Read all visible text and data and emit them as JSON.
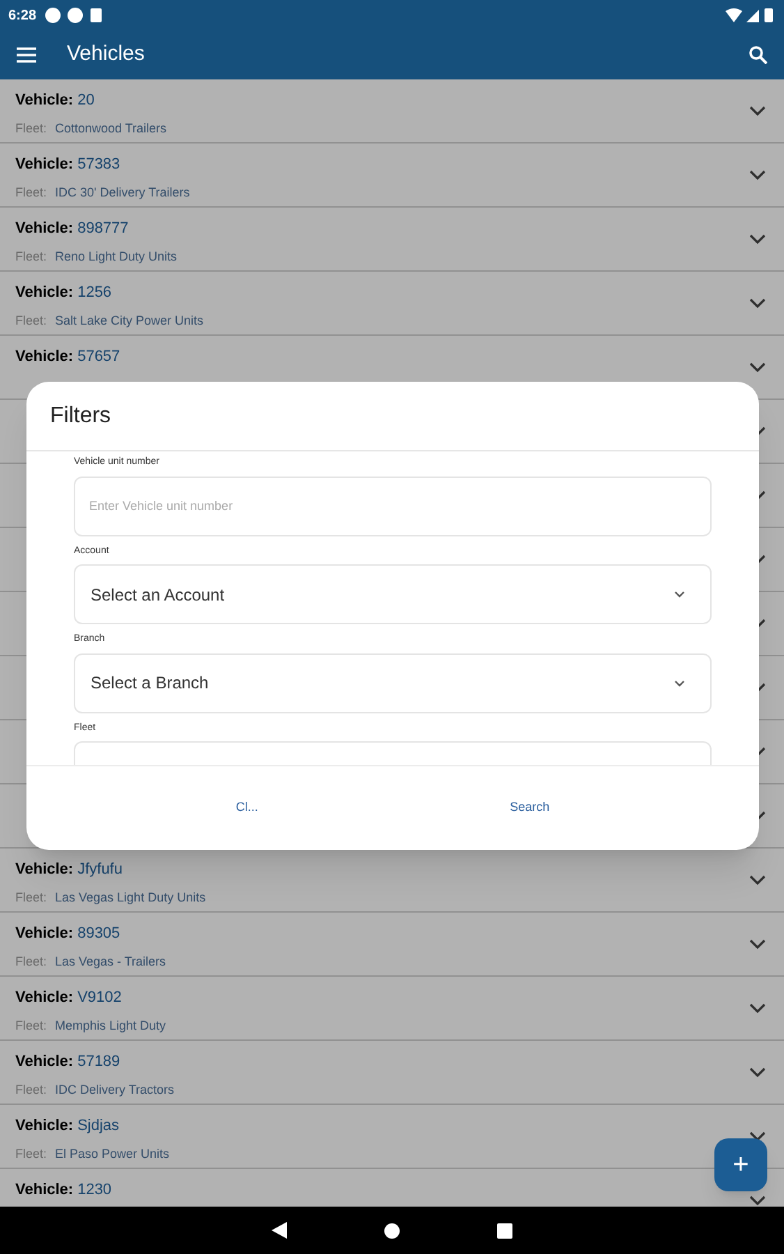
{
  "status_bar": {
    "time": "6:28"
  },
  "app_bar": {
    "title": "Vehicles"
  },
  "rows": [
    {
      "kind": "item",
      "vehicle_label": "Vehicle:",
      "vehicle": "20",
      "fleet_label": "Fleet:",
      "fleet": "Cottonwood Trailers"
    },
    {
      "kind": "item",
      "vehicle_label": "Vehicle:",
      "vehicle": "57383",
      "fleet_label": "Fleet:",
      "fleet": "IDC 30' Delivery Trailers"
    },
    {
      "kind": "item",
      "vehicle_label": "Vehicle:",
      "vehicle": "898777",
      "fleet_label": "Fleet:",
      "fleet": "Reno Light Duty Units"
    },
    {
      "kind": "item",
      "vehicle_label": "Vehicle:",
      "vehicle": "1256",
      "fleet_label": "Fleet:",
      "fleet": "Salt Lake City Power Units"
    },
    {
      "kind": "item",
      "vehicle_label": "Vehicle:",
      "vehicle": "57657"
    },
    {
      "kind": "covered"
    },
    {
      "kind": "covered"
    },
    {
      "kind": "covered"
    },
    {
      "kind": "covered"
    },
    {
      "kind": "covered"
    },
    {
      "kind": "covered"
    },
    {
      "kind": "covered"
    },
    {
      "kind": "item",
      "vehicle_label": "Vehicle:",
      "vehicle": "Jfyfufu",
      "fleet_label": "Fleet:",
      "fleet": "Las Vegas Light Duty Units"
    },
    {
      "kind": "item",
      "vehicle_label": "Vehicle:",
      "vehicle": "89305",
      "fleet_label": "Fleet:",
      "fleet": "Las Vegas - Trailers"
    },
    {
      "kind": "item",
      "vehicle_label": "Vehicle:",
      "vehicle": "V9102",
      "fleet_label": "Fleet:",
      "fleet": "Memphis Light Duty"
    },
    {
      "kind": "item",
      "vehicle_label": "Vehicle:",
      "vehicle": "57189",
      "fleet_label": "Fleet:",
      "fleet": "IDC Delivery Tractors"
    },
    {
      "kind": "item",
      "vehicle_label": "Vehicle:",
      "vehicle": "Sjdjas",
      "fleet_label": "Fleet:",
      "fleet": "El Paso Power Units"
    },
    {
      "kind": "item",
      "vehicle_label": "Vehicle:",
      "vehicle": "1230"
    }
  ],
  "dialog": {
    "title": "Filters",
    "fields": [
      {
        "kind": "text",
        "label": "Vehicle unit number",
        "placeholder": "Enter Vehicle unit number"
      },
      {
        "kind": "select",
        "label": "Account",
        "value": "Select an Account"
      },
      {
        "kind": "select",
        "label": "Branch",
        "value": "Select a Branch"
      },
      {
        "kind": "cut",
        "label": "Fleet"
      }
    ],
    "buttons": [
      "Cl...",
      "Search"
    ]
  },
  "fab": {
    "label": "+"
  }
}
